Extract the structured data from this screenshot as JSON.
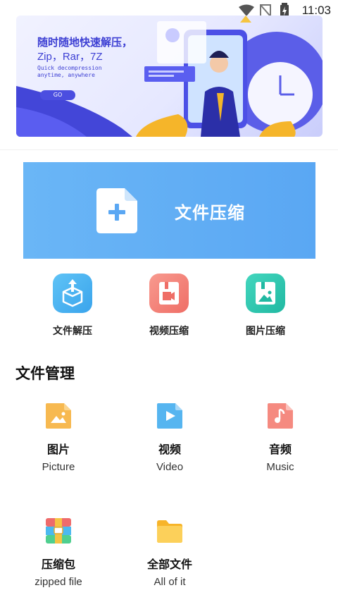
{
  "status_bar": {
    "time": "11:03"
  },
  "banner": {
    "title": "随时随地快速解压，",
    "formats": "Zip，Rar，7Z",
    "subtitle": "Quick decompression anytime, anywhere",
    "button": "GO"
  },
  "compress_card": {
    "label": "文件压缩"
  },
  "tools": [
    {
      "label": "文件解压",
      "color": "#4fb6f3"
    },
    {
      "label": "视频压缩",
      "color": "#f4837b"
    },
    {
      "label": "图片压缩",
      "color": "#34c9b2"
    }
  ],
  "section": {
    "title": "文件管理"
  },
  "files": [
    {
      "cn": "图片",
      "en": "Picture",
      "color": "#f7b950"
    },
    {
      "cn": "视频",
      "en": "Video",
      "color": "#56b5f0"
    },
    {
      "cn": "音频",
      "en": "Music",
      "color": "#f58a80"
    },
    {
      "cn": "压缩包",
      "en": "zipped file",
      "color": "#f2b63e"
    },
    {
      "cn": "全部文件",
      "en": "All of it",
      "color": "#fbbf35"
    }
  ]
}
